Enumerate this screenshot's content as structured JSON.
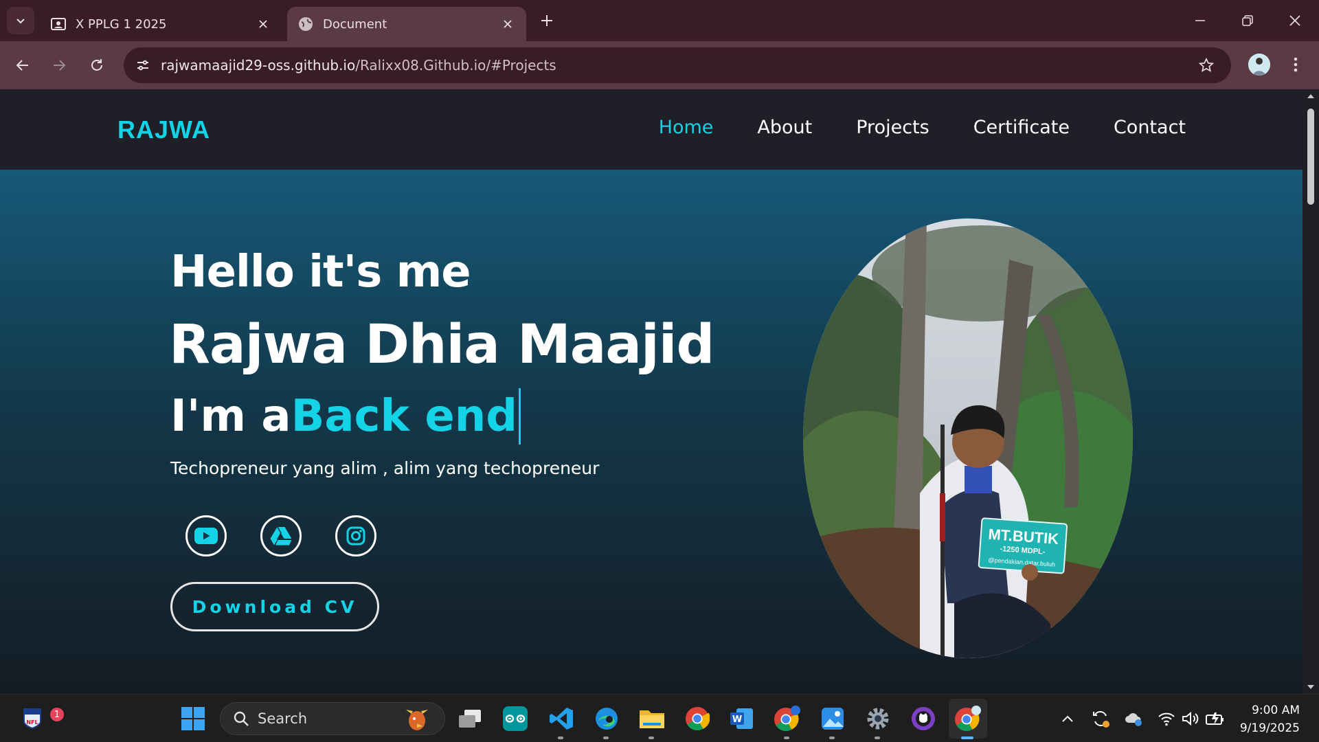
{
  "browser": {
    "tabs": [
      {
        "title": "X PPLG 1 2025",
        "icon": "classroom-icon"
      },
      {
        "title": "Document",
        "icon": "globe-icon"
      }
    ],
    "url": {
      "host": "rajwamaajid29-oss.github.io",
      "path": "/Ralixx08.Github.io/#Projects"
    }
  },
  "site": {
    "logo": "RAJWA",
    "nav": [
      {
        "label": "Home",
        "active": true
      },
      {
        "label": "About",
        "active": false
      },
      {
        "label": "Projects",
        "active": false
      },
      {
        "label": "Certificate",
        "active": false
      },
      {
        "label": "Contact",
        "active": false
      }
    ],
    "hero": {
      "greeting": "Hello it's me",
      "name": "Rajwa Dhia Maajid",
      "role_prefix": "I'm a",
      "role_typed": "Back end",
      "tagline": "Techopreneur yang alim , alim yang techopreneur",
      "socials": [
        "youtube-icon",
        "google-drive-icon",
        "instagram-icon"
      ],
      "cv_button": "Download CV",
      "photo_sign": {
        "line1": "MT.BUTIK",
        "line2": "-1250 MDPL-",
        "line3": "@pendakian.datar.buluh"
      }
    },
    "colors": {
      "accent": "#14d3e6",
      "header_bg": "#1e1f27",
      "hero_top": "#165978",
      "hero_bottom": "#141c24"
    }
  },
  "taskbar": {
    "search_label": "Search",
    "notification_count": "1",
    "time": "9:00 AM",
    "date": "9/19/2025"
  }
}
